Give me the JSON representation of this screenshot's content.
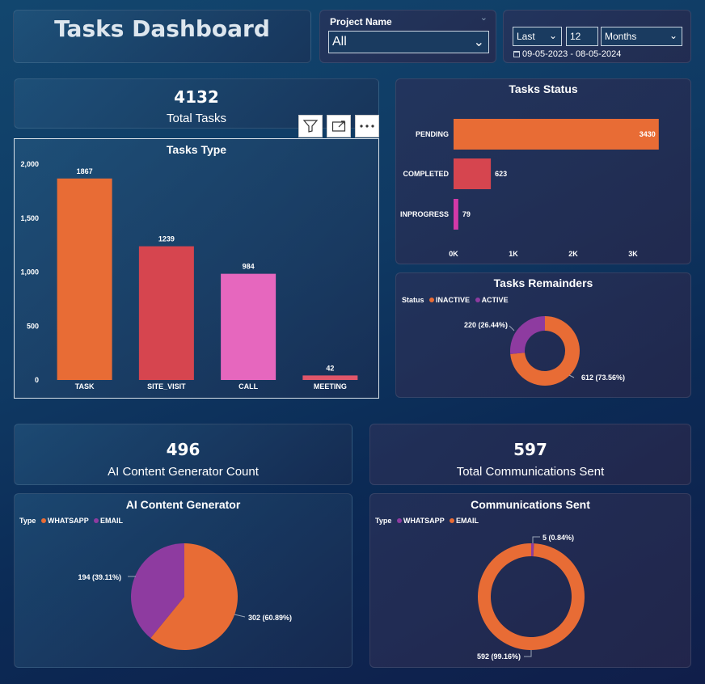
{
  "header": {
    "title": "Tasks Dashboard"
  },
  "project_filter": {
    "label": "Project Name",
    "value": "All"
  },
  "date_filter": {
    "mode": "Last",
    "count": "12",
    "unit": "Months",
    "range": "09-05-2023 - 08-05-2024"
  },
  "kpis": {
    "total_tasks": {
      "value": "4132",
      "label": "Total Tasks"
    },
    "ai_count": {
      "value": "496",
      "label": "AI Content Generator Count"
    },
    "communications": {
      "value": "597",
      "label": "Total Communications Sent"
    }
  },
  "colors": {
    "orange": "#e86c35",
    "red": "#d6454f",
    "pink": "#e667be",
    "magenta": "#d339a8",
    "purple": "#8e3ba0"
  },
  "chart_data": [
    {
      "type": "bar",
      "title": "Tasks Type",
      "categories": [
        "TASK",
        "SITE_VISIT",
        "CALL",
        "MEETING"
      ],
      "values": [
        1867,
        1239,
        984,
        42
      ],
      "data_labels": [
        "1867",
        "1239",
        "984",
        "42"
      ],
      "ylim": [
        0,
        2000
      ],
      "yticks": [
        "0",
        "500",
        "1,000",
        "1,500",
        "2,000"
      ],
      "colors": [
        "#e86c35",
        "#d6454f",
        "#e667be",
        "#e0566a"
      ]
    },
    {
      "type": "bar",
      "orientation": "horizontal",
      "title": "Tasks Status",
      "categories": [
        "PENDING",
        "COMPLETED",
        "INPROGRESS"
      ],
      "values": [
        3430,
        623,
        79
      ],
      "data_labels": [
        "3430",
        "623",
        "79"
      ],
      "xlim": [
        0,
        3400
      ],
      "xticks": [
        "0K",
        "1K",
        "2K",
        "3K"
      ],
      "colors": [
        "#e86c35",
        "#d6454f",
        "#d339a8"
      ]
    },
    {
      "type": "pie",
      "donut": true,
      "title": "Tasks Remainders",
      "legend_title": "Status",
      "categories": [
        "INACTIVE",
        "ACTIVE"
      ],
      "values": [
        612,
        220
      ],
      "data_labels": [
        "612 (73.56%)",
        "220 (26.44%)"
      ],
      "colors": [
        "#e86c35",
        "#8e3ba0"
      ]
    },
    {
      "type": "pie",
      "title": "AI Content Generator",
      "legend_title": "Type",
      "categories": [
        "WHATSAPP",
        "EMAIL"
      ],
      "values": [
        302,
        194
      ],
      "data_labels": [
        "302 (60.89%)",
        "194 (39.11%)"
      ],
      "colors": [
        "#e86c35",
        "#8e3ba0"
      ]
    },
    {
      "type": "pie",
      "donut": true,
      "title": "Communications Sent",
      "legend_title": "Type",
      "categories": [
        "WHATSAPP",
        "EMAIL"
      ],
      "values": [
        5,
        592
      ],
      "data_labels": [
        "5 (0.84%)",
        "592 (99.16%)"
      ],
      "colors": [
        "#8e3ba0",
        "#e86c35"
      ]
    }
  ]
}
